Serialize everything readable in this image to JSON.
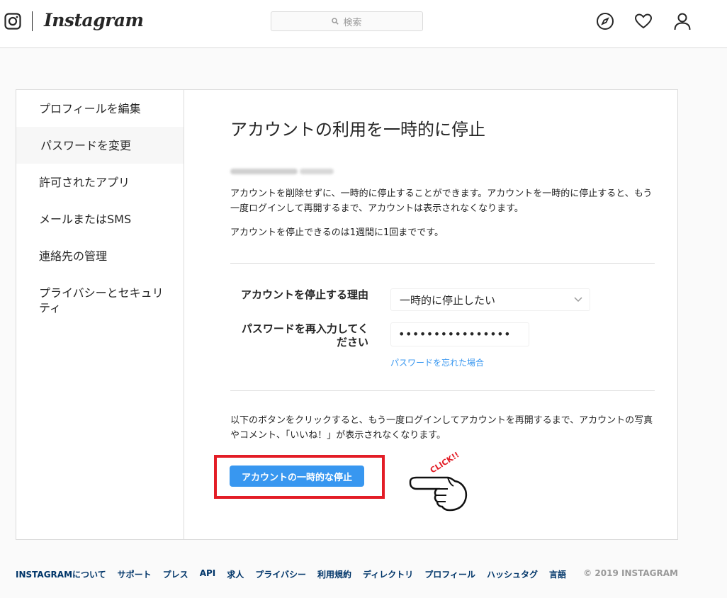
{
  "header": {
    "logo_text": "Instagram",
    "search_placeholder": "検索",
    "icons": [
      "compass-icon",
      "heart-icon",
      "profile-icon"
    ]
  },
  "sidebar": {
    "items": [
      {
        "label": "プロフィールを編集",
        "active": false
      },
      {
        "label": "パスワードを変更",
        "active": true
      },
      {
        "label": "許可されたアプリ",
        "active": false
      },
      {
        "label": "メールまたはSMS",
        "active": false
      },
      {
        "label": "連絡先の管理",
        "active": false
      },
      {
        "label": "プライバシーとセキュリティ",
        "active": false
      }
    ]
  },
  "main": {
    "title": "アカウントの利用を一時的に停止",
    "description_line1": "アカウントを削除せずに、一時的に停止することができます。アカウントを一時的に停止すると、もう一度ログインして再開するまで、アカウントは表示されなくなります。",
    "description_line2": "アカウントを停止できるのは1週間に1回までです。",
    "reason_label": "アカウントを停止する理由",
    "reason_value": "一時的に停止したい",
    "password_label_line1": "パスワードを再入力してく",
    "password_label_line2": "ださい",
    "password_value": "••••••••••••••••",
    "forgot_password": "パスワードを忘れた場合",
    "notice": "以下のボタンをクリックすると、もう一度ログインしてアカウントを再開するまで、アカウントの写真やコメント、「いいね！」が表示されなくなります。",
    "disable_button": "アカウントの一時的な停止",
    "annotation_text": "CLICK!!"
  },
  "footer": {
    "links": [
      "INSTAGRAMについて",
      "サポート",
      "プレス",
      "API",
      "求人",
      "プライバシー",
      "利用規約",
      "ディレクトリ",
      "プロフィール",
      "ハッシュタグ",
      "言語"
    ],
    "copyright": "© 2019 INSTAGRAM"
  },
  "colors": {
    "accent": "#3897f0",
    "highlight_border": "#e31d26",
    "link_dark": "#003569"
  }
}
